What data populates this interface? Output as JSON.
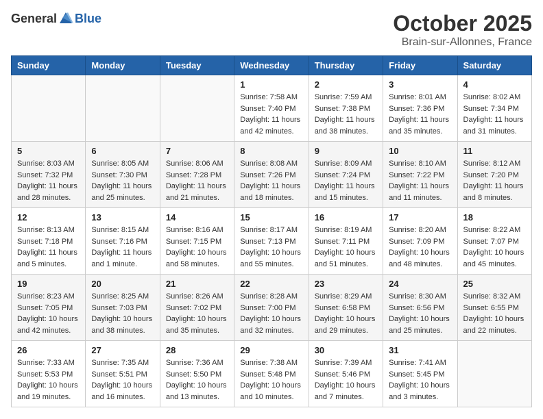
{
  "header": {
    "logo_general": "General",
    "logo_blue": "Blue",
    "month": "October 2025",
    "location": "Brain-sur-Allonnes, France"
  },
  "columns": [
    "Sunday",
    "Monday",
    "Tuesday",
    "Wednesday",
    "Thursday",
    "Friday",
    "Saturday"
  ],
  "weeks": [
    [
      {
        "day": "",
        "info": ""
      },
      {
        "day": "",
        "info": ""
      },
      {
        "day": "",
        "info": ""
      },
      {
        "day": "1",
        "info": "Sunrise: 7:58 AM\nSunset: 7:40 PM\nDaylight: 11 hours\nand 42 minutes."
      },
      {
        "day": "2",
        "info": "Sunrise: 7:59 AM\nSunset: 7:38 PM\nDaylight: 11 hours\nand 38 minutes."
      },
      {
        "day": "3",
        "info": "Sunrise: 8:01 AM\nSunset: 7:36 PM\nDaylight: 11 hours\nand 35 minutes."
      },
      {
        "day": "4",
        "info": "Sunrise: 8:02 AM\nSunset: 7:34 PM\nDaylight: 11 hours\nand 31 minutes."
      }
    ],
    [
      {
        "day": "5",
        "info": "Sunrise: 8:03 AM\nSunset: 7:32 PM\nDaylight: 11 hours\nand 28 minutes."
      },
      {
        "day": "6",
        "info": "Sunrise: 8:05 AM\nSunset: 7:30 PM\nDaylight: 11 hours\nand 25 minutes."
      },
      {
        "day": "7",
        "info": "Sunrise: 8:06 AM\nSunset: 7:28 PM\nDaylight: 11 hours\nand 21 minutes."
      },
      {
        "day": "8",
        "info": "Sunrise: 8:08 AM\nSunset: 7:26 PM\nDaylight: 11 hours\nand 18 minutes."
      },
      {
        "day": "9",
        "info": "Sunrise: 8:09 AM\nSunset: 7:24 PM\nDaylight: 11 hours\nand 15 minutes."
      },
      {
        "day": "10",
        "info": "Sunrise: 8:10 AM\nSunset: 7:22 PM\nDaylight: 11 hours\nand 11 minutes."
      },
      {
        "day": "11",
        "info": "Sunrise: 8:12 AM\nSunset: 7:20 PM\nDaylight: 11 hours\nand 8 minutes."
      }
    ],
    [
      {
        "day": "12",
        "info": "Sunrise: 8:13 AM\nSunset: 7:18 PM\nDaylight: 11 hours\nand 5 minutes."
      },
      {
        "day": "13",
        "info": "Sunrise: 8:15 AM\nSunset: 7:16 PM\nDaylight: 11 hours\nand 1 minute."
      },
      {
        "day": "14",
        "info": "Sunrise: 8:16 AM\nSunset: 7:15 PM\nDaylight: 10 hours\nand 58 minutes."
      },
      {
        "day": "15",
        "info": "Sunrise: 8:17 AM\nSunset: 7:13 PM\nDaylight: 10 hours\nand 55 minutes."
      },
      {
        "day": "16",
        "info": "Sunrise: 8:19 AM\nSunset: 7:11 PM\nDaylight: 10 hours\nand 51 minutes."
      },
      {
        "day": "17",
        "info": "Sunrise: 8:20 AM\nSunset: 7:09 PM\nDaylight: 10 hours\nand 48 minutes."
      },
      {
        "day": "18",
        "info": "Sunrise: 8:22 AM\nSunset: 7:07 PM\nDaylight: 10 hours\nand 45 minutes."
      }
    ],
    [
      {
        "day": "19",
        "info": "Sunrise: 8:23 AM\nSunset: 7:05 PM\nDaylight: 10 hours\nand 42 minutes."
      },
      {
        "day": "20",
        "info": "Sunrise: 8:25 AM\nSunset: 7:03 PM\nDaylight: 10 hours\nand 38 minutes."
      },
      {
        "day": "21",
        "info": "Sunrise: 8:26 AM\nSunset: 7:02 PM\nDaylight: 10 hours\nand 35 minutes."
      },
      {
        "day": "22",
        "info": "Sunrise: 8:28 AM\nSunset: 7:00 PM\nDaylight: 10 hours\nand 32 minutes."
      },
      {
        "day": "23",
        "info": "Sunrise: 8:29 AM\nSunset: 6:58 PM\nDaylight: 10 hours\nand 29 minutes."
      },
      {
        "day": "24",
        "info": "Sunrise: 8:30 AM\nSunset: 6:56 PM\nDaylight: 10 hours\nand 25 minutes."
      },
      {
        "day": "25",
        "info": "Sunrise: 8:32 AM\nSunset: 6:55 PM\nDaylight: 10 hours\nand 22 minutes."
      }
    ],
    [
      {
        "day": "26",
        "info": "Sunrise: 7:33 AM\nSunset: 5:53 PM\nDaylight: 10 hours\nand 19 minutes."
      },
      {
        "day": "27",
        "info": "Sunrise: 7:35 AM\nSunset: 5:51 PM\nDaylight: 10 hours\nand 16 minutes."
      },
      {
        "day": "28",
        "info": "Sunrise: 7:36 AM\nSunset: 5:50 PM\nDaylight: 10 hours\nand 13 minutes."
      },
      {
        "day": "29",
        "info": "Sunrise: 7:38 AM\nSunset: 5:48 PM\nDaylight: 10 hours\nand 10 minutes."
      },
      {
        "day": "30",
        "info": "Sunrise: 7:39 AM\nSunset: 5:46 PM\nDaylight: 10 hours\nand 7 minutes."
      },
      {
        "day": "31",
        "info": "Sunrise: 7:41 AM\nSunset: 5:45 PM\nDaylight: 10 hours\nand 3 minutes."
      },
      {
        "day": "",
        "info": ""
      }
    ]
  ]
}
